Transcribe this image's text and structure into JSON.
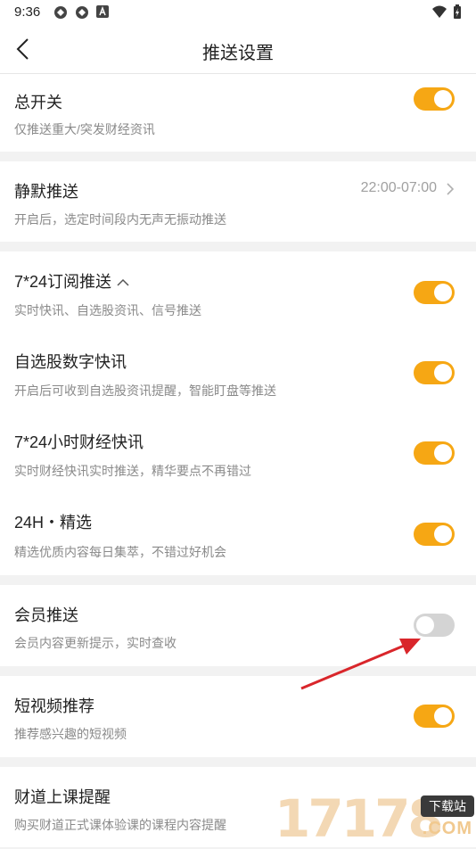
{
  "status_bar": {
    "time": "9:36"
  },
  "header": {
    "title": "推送设置"
  },
  "settings": {
    "master": {
      "title": "总开关",
      "desc": "仅推送重大/突发财经资讯",
      "enabled": true
    },
    "quiet": {
      "title": "静默推送",
      "desc": "开启后，选定时间段内无声无振动推送",
      "time_range": "22:00-07:00"
    },
    "subscription": {
      "title": "7*24订阅推送",
      "desc": "实时快讯、自选股资讯、信号推送",
      "enabled": true
    },
    "watchlist": {
      "title": "自选股数字快讯",
      "desc": "开启后可收到自选股资讯提醒，智能盯盘等推送",
      "enabled": true
    },
    "finance24": {
      "title": "7*24小时财经快讯",
      "desc": "实时财经快讯实时推送，精华要点不再错过",
      "enabled": true
    },
    "featured": {
      "title": "24H・精选",
      "desc": "精选优质内容每日集萃，不错过好机会",
      "enabled": true
    },
    "member": {
      "title": "会员推送",
      "desc": "会员内容更新提示，实时查收",
      "enabled": false
    },
    "short_video": {
      "title": "短视频推荐",
      "desc": "推荐感兴趣的短视频",
      "enabled": true
    },
    "class_reminder": {
      "title": "财道上课提醒",
      "desc": "购买财道正式课体验课的课程内容提醒"
    }
  },
  "watermark": {
    "number": "17178",
    "badge": "下载站",
    "domain": ".COM"
  },
  "colors": {
    "accent": "#f6a714",
    "toggle_off": "#d4d4d4",
    "arrow": "#d9262b"
  }
}
